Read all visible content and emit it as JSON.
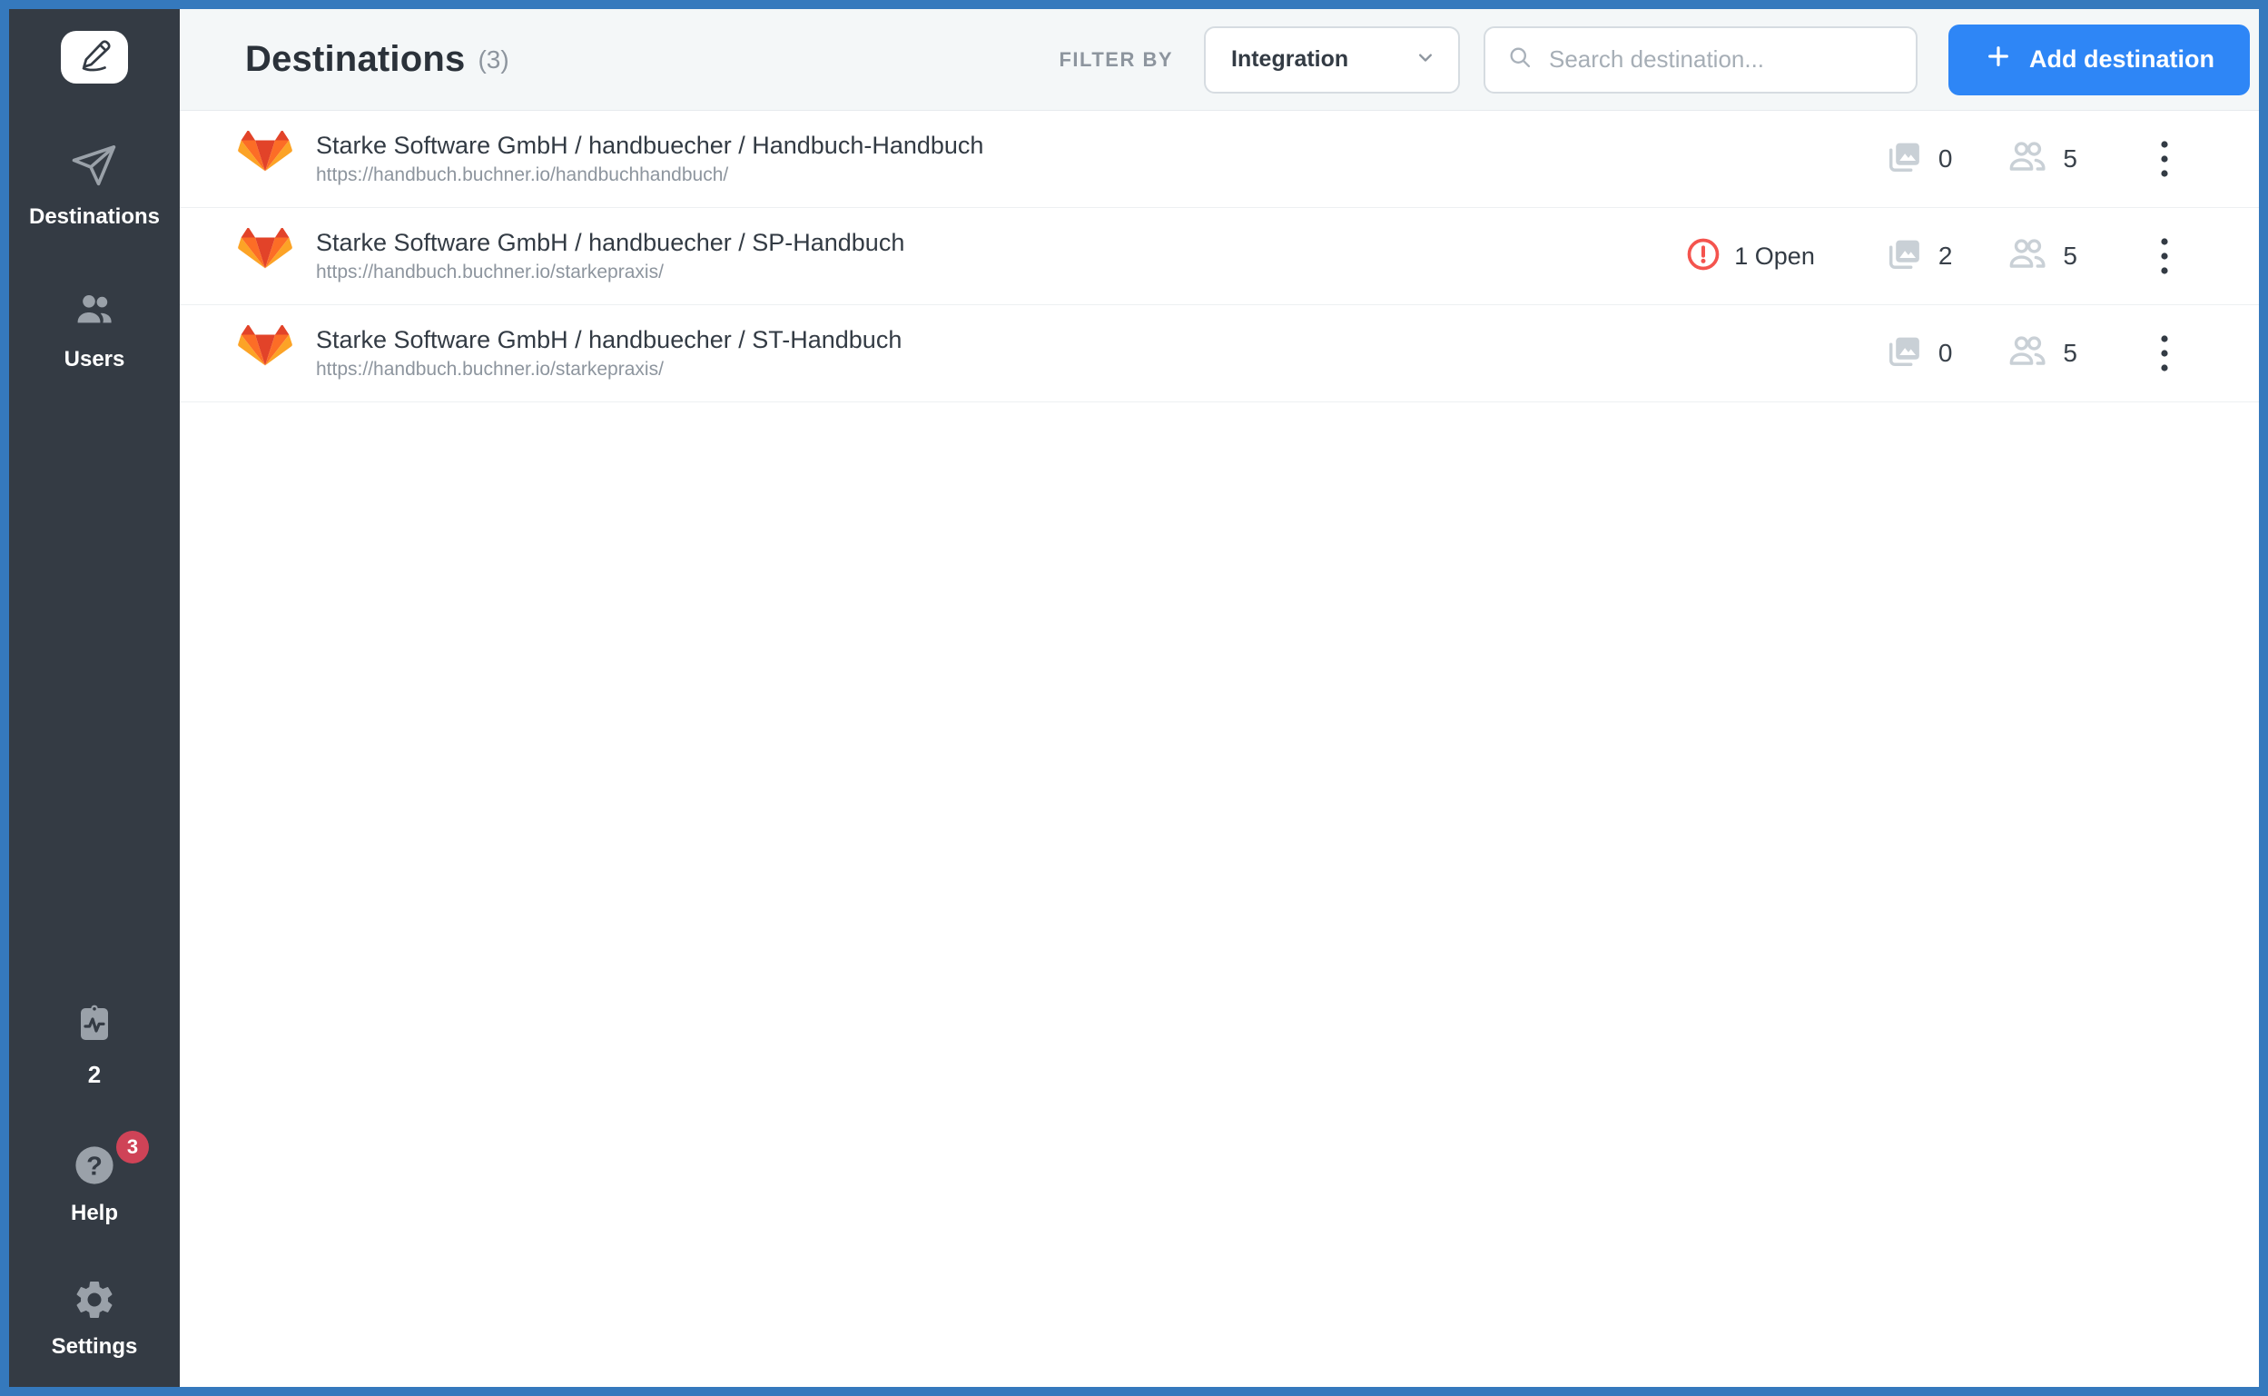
{
  "sidebar": {
    "logo_icon": "pencil-logo",
    "nav": [
      {
        "label": "Destinations",
        "icon": "paper-plane-icon"
      },
      {
        "label": "Users",
        "icon": "users-icon"
      }
    ],
    "bottom": {
      "activity": {
        "label": "2",
        "icon": "activity-clipboard-icon"
      },
      "help": {
        "label": "Help",
        "icon": "question-mark-icon",
        "badge": "3"
      },
      "settings": {
        "label": "Settings",
        "icon": "gear-icon"
      }
    }
  },
  "header": {
    "title": "Destinations",
    "count": "(3)",
    "filter_label": "FILTER BY",
    "filter_value": "Integration",
    "search_placeholder": "Search destination...",
    "add_button": "Add destination"
  },
  "rows": [
    {
      "title": "Starke Software GmbH / handbuecher / Handbuch-Handbuch",
      "url": "https://handbuch.buchner.io/handbuchhandbuch/",
      "images_count": "0",
      "users_count": "5"
    },
    {
      "title": "Starke Software GmbH / handbuecher / SP-Handbuch",
      "url": "https://handbuch.buchner.io/starkepraxis/",
      "open_label": "1 Open",
      "images_count": "2",
      "users_count": "5"
    },
    {
      "title": "Starke Software GmbH / handbuecher / ST-Handbuch",
      "url": "https://handbuch.buchner.io/starkepraxis/",
      "images_count": "0",
      "users_count": "5"
    }
  ],
  "colors": {
    "frame_blue": "#3579bd",
    "sidebar_bg": "#343b44",
    "accent_blue": "#2e86f6",
    "badge_red": "#cf4357",
    "alert_red": "#f4544e",
    "header_bg": "#f4f7f8",
    "sidebar_icon_gray": "#9aa1a9",
    "stat_icon_gray": "#c9d0d6",
    "gitlab_red": "#e24329",
    "gitlab_orange": "#fc6d26",
    "gitlab_light_orange": "#fca326"
  }
}
